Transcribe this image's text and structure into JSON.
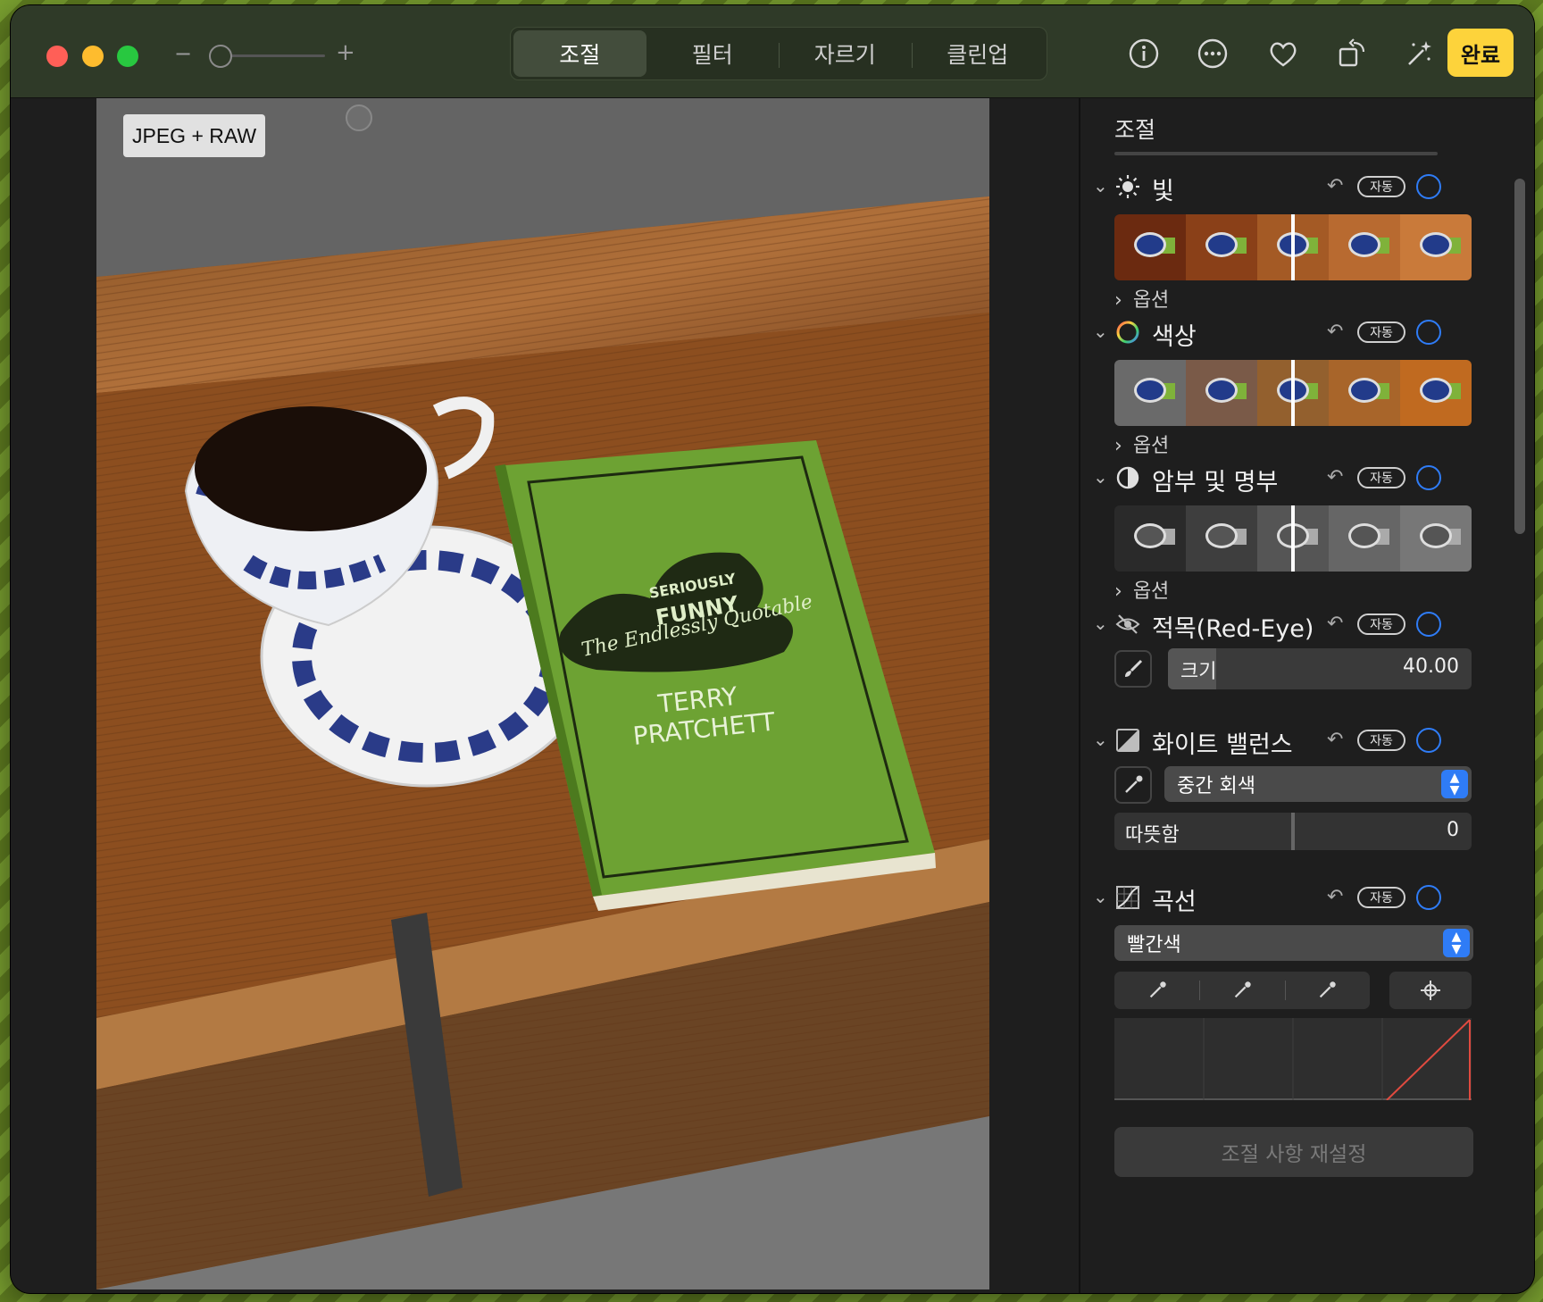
{
  "toolbar": {
    "zoom_minus": "−",
    "zoom_plus": "+",
    "tabs": [
      {
        "label": "조절",
        "active": true
      },
      {
        "label": "필터",
        "active": false
      },
      {
        "label": "자르기",
        "active": false
      },
      {
        "label": "클린업",
        "active": false
      }
    ],
    "icons": [
      "info-icon",
      "more-icon",
      "heart-icon",
      "rotate-icon",
      "magic-wand-icon"
    ],
    "done_label": "완료"
  },
  "photo": {
    "badge": "JPEG + RAW",
    "book_line1": "SERIOUSLY",
    "book_line2": "FUNNY",
    "book_line3": "The Endlessly Quotable",
    "book_author1": "TERRY",
    "book_author2": "PRATCHETT"
  },
  "panel": {
    "title": "조절",
    "sections": {
      "light": {
        "label": "빛",
        "auto": "자동",
        "options": "옵션"
      },
      "color": {
        "label": "색상",
        "auto": "자동",
        "options": "옵션"
      },
      "bw": {
        "label": "암부 및 명부",
        "auto": "자동",
        "options": "옵션"
      },
      "redeye": {
        "label": "적목(Red-Eye)",
        "auto": "자동",
        "size_label": "크기",
        "size_value": "40.00",
        "size_fill": 0.16
      },
      "wb": {
        "label": "화이트 밸런스",
        "auto": "자동",
        "mode": "중간 회색",
        "warmth_label": "따뜻함",
        "warmth_value": "0",
        "warmth_fill": 0.5
      },
      "curves": {
        "label": "곡선",
        "auto": "자동",
        "channel": "빨간색"
      }
    },
    "reset_label": "조절 사항 재설정",
    "accent_color": "#2f7cf6",
    "done_color": "#fdd33b"
  }
}
